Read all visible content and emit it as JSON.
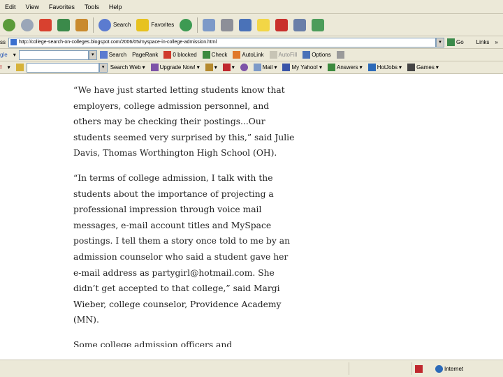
{
  "menu": [
    "Edit",
    "View",
    "Favorites",
    "Tools",
    "Help"
  ],
  "toolbar": {
    "search_label": "Search",
    "favorites_label": "Favorites"
  },
  "address": {
    "label": "ss",
    "url": "http://college-search-on-colleges.blogspot.com/2006/05/myspace-in-college-admission.html",
    "go_label": "Go",
    "links_label": "Links"
  },
  "google_toolbar": {
    "brand": "gle",
    "search_label": "Search",
    "pagerank_label": "PageRank",
    "blocked_label": "0 blocked",
    "check_label": "Check",
    "autolink_label": "AutoLink",
    "autofill_label": "AutoFill",
    "options_label": "Options"
  },
  "yahoo_toolbar": {
    "search_web_label": "Search Web",
    "upgrade_label": "Upgrade Now!",
    "mail_label": "Mail",
    "my_yahoo_label": "My Yahoo!",
    "answers_label": "Answers",
    "hotjobs_label": "HotJobs",
    "games_label": "Games"
  },
  "article": {
    "paragraphs": [
      "“We have just started letting students know that employers, college admission personnel, and others may be checking their postings...Our students seemed very surprised by this,” said Julie Davis, Thomas Worthington High School (OH).",
      "“In terms of college admission, I talk with the students about the importance of projecting a professional impression through voice mail messages, e-mail account titles and MySpace postings. I tell them a story once told to me by an admission counselor who said a student gave her e-mail address as partygirl@hotmail.com. She didn’t get accepted to that college,” said Margi Wieber, college counselor, Providence Academy (MN)."
    ],
    "cut_line": "Some college admission officers and"
  },
  "status": {
    "zone_label": "Internet"
  }
}
